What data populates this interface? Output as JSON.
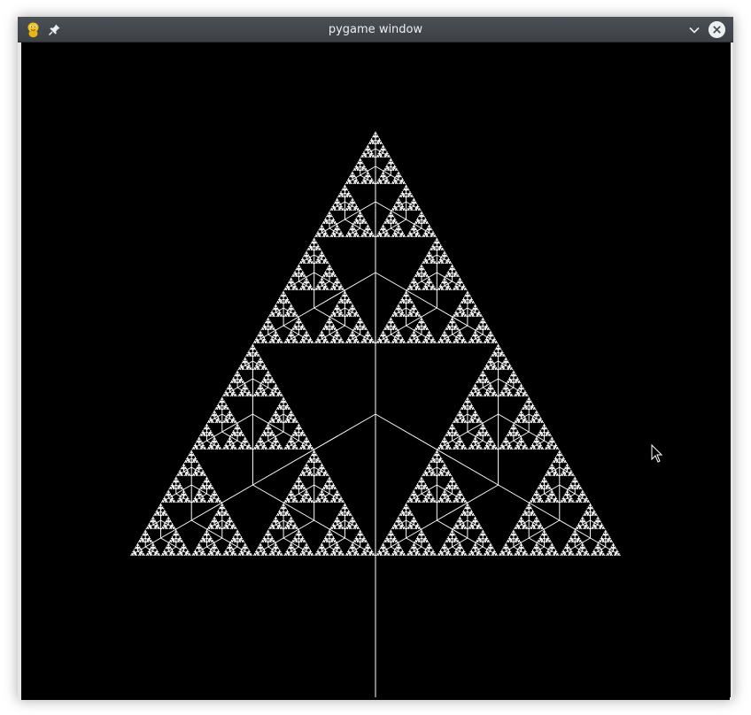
{
  "window": {
    "title": "pygame window",
    "icons": {
      "app": "pygame-snake-icon",
      "pin": "pin-icon",
      "minimize": "chevron-down-icon",
      "close": "close-icon"
    }
  },
  "canvas": {
    "background": "#000000",
    "stroke": "#ffffff",
    "content": "fractal-tree"
  },
  "colors": {
    "titlebar": "#43474c",
    "titlebar_text": "#eceff1",
    "frame": "#e3e5e7"
  }
}
